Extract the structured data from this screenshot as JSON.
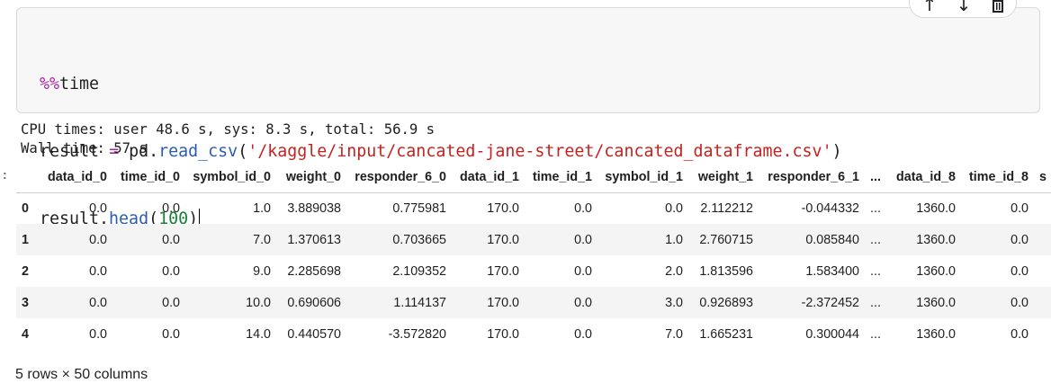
{
  "toolbar": {
    "move_up_icon": "arrow-up-icon",
    "move_down_icon": "arrow-down-icon",
    "delete_icon": "trash-icon"
  },
  "code": {
    "line1_magic_prefix": "%%",
    "line1_magic_name": "time",
    "line2": {
      "var": "result",
      "eq": "=",
      "obj": "pd.",
      "func": "read_csv",
      "open": "(",
      "arg": "'/kaggle/input/cancated-jane-street/cancated_dataframe.csv'",
      "close": ")"
    },
    "line3": {
      "var": "result.",
      "func": "head",
      "open": "(",
      "arg": "100",
      "close": ")"
    }
  },
  "stdout": {
    "line1": "CPU times: user 48.6 s, sys: 8.3 s, total: 56.9 s",
    "line2": "Wall time: 57 s"
  },
  "output_marker": ":",
  "dataframe": {
    "columns": [
      "",
      "data_id_0",
      "time_id_0",
      "symbol_id_0",
      "weight_0",
      "responder_6_0",
      "data_id_1",
      "time_id_1",
      "symbol_id_1",
      "weight_1",
      "responder_6_1",
      "...",
      "data_id_8",
      "time_id_8",
      "s"
    ],
    "rows": [
      [
        "0",
        "0.0",
        "0.0",
        "1.0",
        "3.889038",
        "0.775981",
        "170.0",
        "0.0",
        "0.0",
        "2.112212",
        "-0.044332",
        "...",
        "1360.0",
        "0.0",
        ""
      ],
      [
        "1",
        "0.0",
        "0.0",
        "7.0",
        "1.370613",
        "0.703665",
        "170.0",
        "0.0",
        "1.0",
        "2.760715",
        "0.085840",
        "...",
        "1360.0",
        "0.0",
        ""
      ],
      [
        "2",
        "0.0",
        "0.0",
        "9.0",
        "2.285698",
        "2.109352",
        "170.0",
        "0.0",
        "2.0",
        "1.813596",
        "1.583400",
        "...",
        "1360.0",
        "0.0",
        ""
      ],
      [
        "3",
        "0.0",
        "0.0",
        "10.0",
        "0.690606",
        "1.114137",
        "170.0",
        "0.0",
        "3.0",
        "0.926893",
        "-2.372452",
        "...",
        "1360.0",
        "0.0",
        ""
      ],
      [
        "4",
        "0.0",
        "0.0",
        "14.0",
        "0.440570",
        "-3.572820",
        "170.0",
        "0.0",
        "7.0",
        "1.665231",
        "0.300044",
        "...",
        "1360.0",
        "0.0",
        ""
      ]
    ],
    "shape_note": "5 rows × 50 columns"
  }
}
